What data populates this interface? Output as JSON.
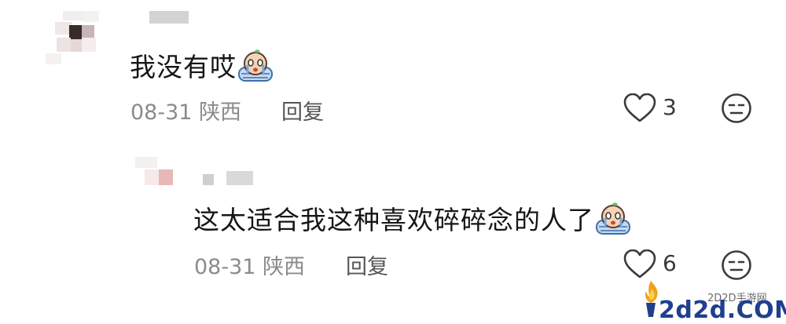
{
  "comments": [
    {
      "text": "我没有哎",
      "sticker": "crying-sticker-icon",
      "date": "08-31",
      "location": "陕西",
      "reply_label": "回复",
      "likes": "3",
      "dislike_icon": "meh-face-icon"
    },
    {
      "text": "这太适合我这种喜欢碎碎念的人了",
      "sticker": "crying-sticker-icon",
      "date": "08-31",
      "location": "陕西",
      "reply_label": "回复",
      "likes": "6",
      "dislike_icon": "meh-face-icon"
    }
  ],
  "watermark": {
    "site_name": "2D2D手游网",
    "domain": "2d2d.COM"
  },
  "colors": {
    "text": "#161616",
    "meta": "#8b8b8b",
    "watermark_blue": "#1f3f8f",
    "flame_orange": "#f2a01a"
  }
}
